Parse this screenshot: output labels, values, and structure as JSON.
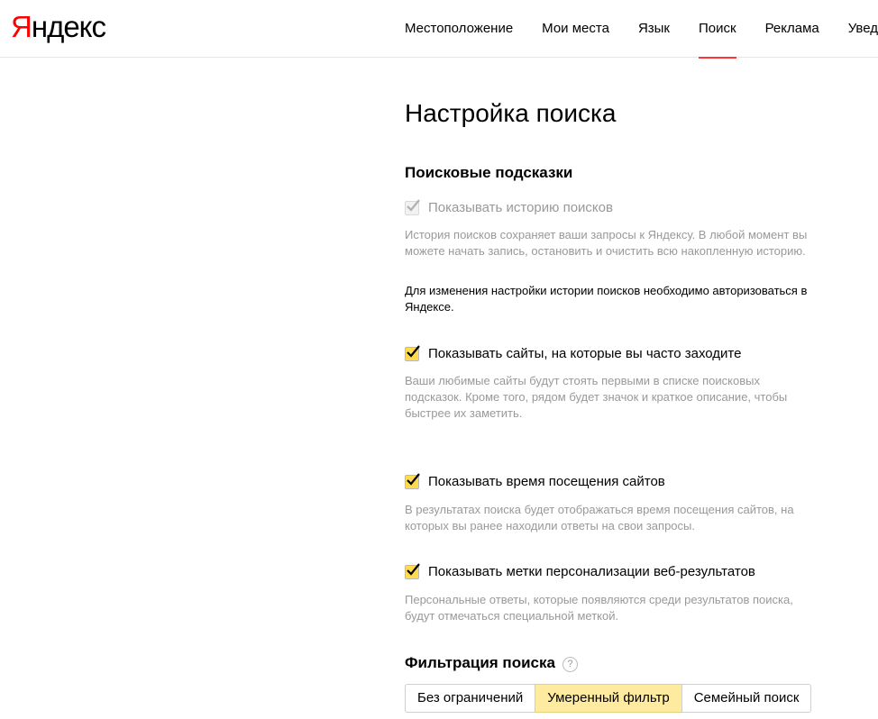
{
  "header": {
    "logo_first": "Я",
    "logo_rest": "ндекс",
    "nav": [
      {
        "label": "Местоположение"
      },
      {
        "label": "Мои места"
      },
      {
        "label": "Язык"
      },
      {
        "label": "Поиск",
        "active": true
      },
      {
        "label": "Реклама"
      },
      {
        "label": "Увед"
      }
    ]
  },
  "page": {
    "title": "Настройка поиска"
  },
  "suggest": {
    "title": "Поисковые подсказки",
    "history": {
      "label": "Показывать историю поисков",
      "checked": true,
      "disabled": true,
      "desc": "История поисков сохраняет ваши запросы к Яндексу. В любой момент вы можете начать запись, остановить и очистить всю накопленную историю.",
      "note": "Для изменения настройки истории поисков необходимо авторизоваться в Яндексе."
    },
    "frequent_sites": {
      "label": "Показывать сайты, на которые вы часто заходите",
      "checked": true,
      "desc": "Ваши любимые сайты будут стоять первыми в списке поисковых подсказок. Кроме того, рядом будет значок и краткое описание, чтобы быстрее их заметить."
    },
    "visit_time": {
      "label": "Показывать время посещения сайтов",
      "checked": true,
      "desc": "В результатах поиска будет отображаться время посещения сайтов, на которых вы ранее находили ответы на свои запросы."
    },
    "personal_marks": {
      "label": "Показывать метки персонализации веб-результатов",
      "checked": true,
      "desc": "Персональные ответы, которые появляются среди результатов поиска, будут отмечаться специальной меткой."
    }
  },
  "filter": {
    "title": "Фильтрация поиска",
    "help": "?",
    "options": [
      {
        "label": "Без ограничений"
      },
      {
        "label": "Умеренный фильтр",
        "selected": true
      },
      {
        "label": "Семейный поиск"
      }
    ]
  },
  "colors": {
    "accent_red": "#ff0000",
    "checkbox_yellow": "#ffdb4d",
    "selected_yellow": "#ffeba0"
  }
}
